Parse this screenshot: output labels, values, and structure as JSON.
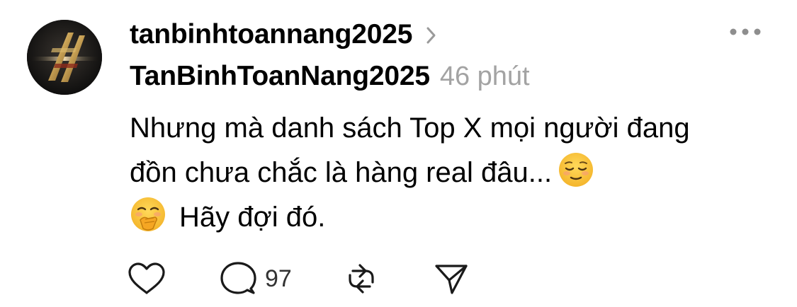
{
  "post": {
    "username": "tanbinhtoannang2025",
    "display_name": "TanBinhToanNang2025",
    "time": "46 phút",
    "line1": "Nhưng mà danh sách Top X mọi người đang",
    "line2": "đồn chưa chắc là hàng real đâu...",
    "line3": "Hãy đợi đó.",
    "emojis": [
      "relieved-face",
      "face-with-hand-over-mouth"
    ]
  },
  "actions": {
    "reply_count": "97",
    "icons": [
      "heart-icon",
      "comment-icon",
      "repost-icon",
      "share-icon"
    ]
  },
  "colors": {
    "text": "#000000",
    "muted": "#a3a3a3",
    "icon": "#1a1a1a",
    "emoji_yellow": "#f7c338"
  }
}
